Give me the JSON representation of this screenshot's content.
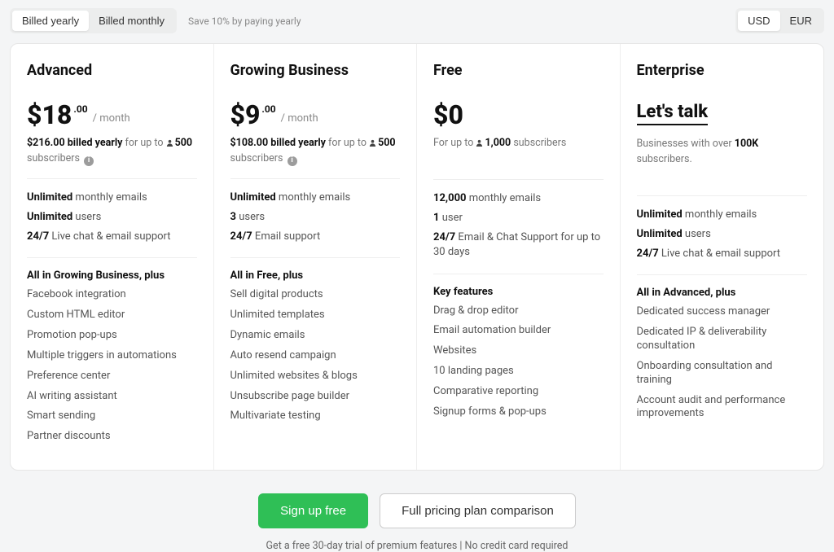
{
  "topbar": {
    "billed_yearly": "Billed yearly",
    "billed_monthly": "Billed monthly",
    "save_note": "Save 10% by paying yearly",
    "usd": "USD",
    "eur": "EUR"
  },
  "plans": [
    {
      "name": "Advanced",
      "price_main": "$18",
      "price_cents": ".00",
      "price_per": "/ month",
      "billed_prefix": "$216.00 billed yearly",
      "billed_mid": " for up to ",
      "billed_count": "500",
      "billed_suffix": " subscribers ",
      "lines": [
        {
          "bold": "Unlimited",
          "rest": " monthly emails"
        },
        {
          "bold": "Unlimited",
          "rest": " users"
        },
        {
          "bold": "24/7",
          "rest": " Live chat & email support"
        }
      ],
      "section_title": "All in Growing Business, plus",
      "features": [
        "Facebook integration",
        "Custom HTML editor",
        "Promotion pop-ups",
        "Multiple triggers in automations",
        "Preference center",
        "AI writing assistant",
        "Smart sending",
        "Partner discounts"
      ]
    },
    {
      "name": "Growing Business",
      "price_main": "$9",
      "price_cents": ".00",
      "price_per": "/ month",
      "billed_prefix": "$108.00 billed yearly",
      "billed_mid": " for up to ",
      "billed_count": "500",
      "billed_suffix": " subscribers ",
      "lines": [
        {
          "bold": "Unlimited",
          "rest": " monthly emails"
        },
        {
          "bold": "3",
          "rest": " users"
        },
        {
          "bold": "24/7",
          "rest": " Email support"
        }
      ],
      "section_title": "All in Free, plus",
      "features": [
        "Sell digital products",
        "Unlimited templates",
        "Dynamic emails",
        "Auto resend campaign",
        "Unlimited websites & blogs",
        "Unsubscribe page builder",
        "Multivariate testing"
      ]
    },
    {
      "name": "Free",
      "price_main": "$0",
      "sub_prefix": "For up to ",
      "sub_count": "1,000",
      "sub_suffix": " subscribers",
      "lines": [
        {
          "bold": "12,000",
          "rest": " monthly emails"
        },
        {
          "bold": "1",
          "rest": " user"
        },
        {
          "bold": "24/7",
          "rest": " Email & Chat Support for up to 30 days"
        }
      ],
      "section_title": "Key features",
      "features": [
        "Drag & drop editor",
        "Email automation builder",
        "Websites",
        "10 landing pages",
        "Comparative reporting",
        "Signup forms & pop-ups"
      ]
    },
    {
      "name": "Enterprise",
      "lets_talk": "Let's talk",
      "sub_prefix": "Businesses with over ",
      "sub_bold": "100K",
      "sub_suffix": " subscribers.",
      "lines": [
        {
          "bold": "Unlimited",
          "rest": " monthly emails"
        },
        {
          "bold": "Unlimited",
          "rest": " users"
        },
        {
          "bold": "24/7",
          "rest": " Live chat & email support"
        }
      ],
      "section_title": "All in Advanced, plus",
      "features": [
        "Dedicated success manager",
        "Dedicated IP & deliverability consultation",
        "Onboarding consultation and training",
        "Account audit and performance improvements"
      ]
    }
  ],
  "cta": {
    "primary": "Sign up free",
    "secondary": "Full pricing plan comparison",
    "footnote": "Get a free 30-day trial of premium features | No credit card required"
  }
}
